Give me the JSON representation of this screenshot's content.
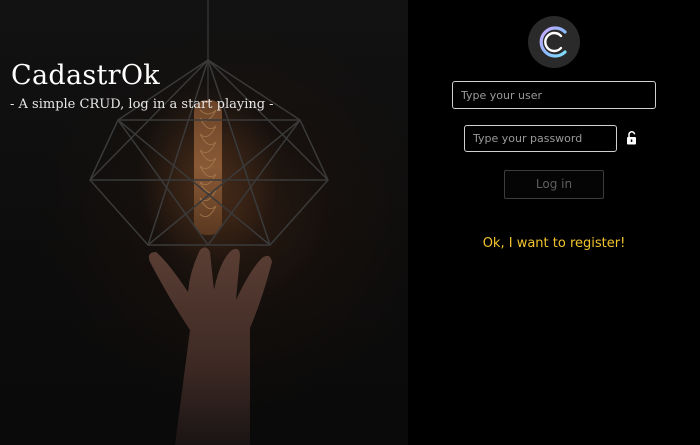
{
  "hero": {
    "title": "CadastrOk",
    "tagline": "- A simple CRUD, log in a start playing -"
  },
  "login": {
    "user_placeholder": "Type your user",
    "password_placeholder": "Type your password",
    "login_label": "Log in",
    "register_label": "Ok, I want to register!"
  },
  "icons": {
    "logo": "c-logo-icon",
    "lock": "unlock-icon"
  },
  "colors": {
    "background": "#000000",
    "register_link": "#f2c42b",
    "field_border": "#cfcfcf",
    "button_text": "#5e5e5e"
  }
}
